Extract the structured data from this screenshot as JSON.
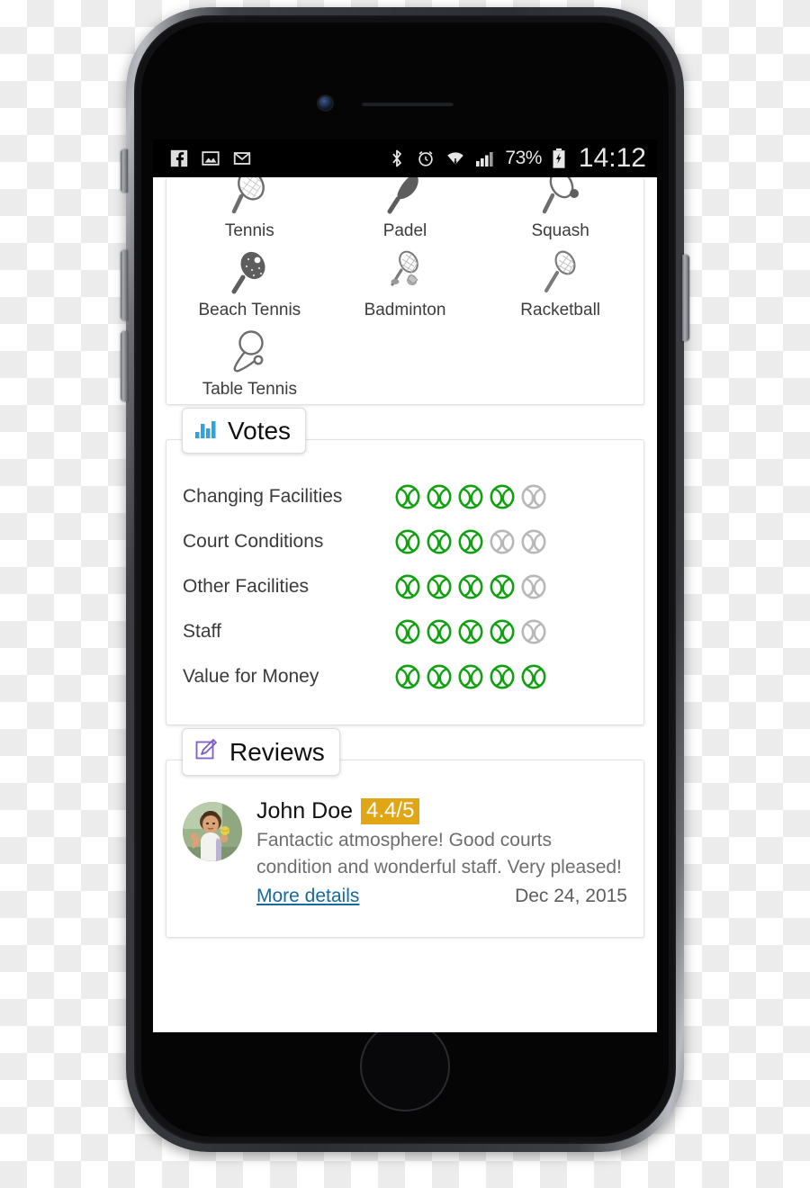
{
  "statusbar": {
    "left_icons": [
      "facebook-icon",
      "photos-icon",
      "gmail-icon"
    ],
    "right_icons": [
      "bluetooth-icon",
      "alarm-icon",
      "wifi-icon",
      "signal-icon"
    ],
    "battery_percent": "73%",
    "battery_icon": "battery-charging-icon",
    "clock": "14:12"
  },
  "sports": {
    "items": [
      {
        "label": "Tennis",
        "icon": "tennis-racket-icon"
      },
      {
        "label": "Padel",
        "icon": "padel-racket-icon"
      },
      {
        "label": "Squash",
        "icon": "squash-racket-icon"
      },
      {
        "label": "Beach Tennis",
        "icon": "beach-tennis-racket-icon"
      },
      {
        "label": "Badminton",
        "icon": "badminton-racket-icon"
      },
      {
        "label": "Racketball",
        "icon": "racketball-racket-icon"
      },
      {
        "label": "Table Tennis",
        "icon": "table-tennis-paddle-icon"
      }
    ]
  },
  "votes": {
    "title": "Votes",
    "icon": "bar-chart-icon",
    "max": 5,
    "rows": [
      {
        "label": "Changing Facilities",
        "value": 4
      },
      {
        "label": "Court Conditions",
        "value": 3
      },
      {
        "label": "Other Facilities",
        "value": 4
      },
      {
        "label": "Staff",
        "value": 4
      },
      {
        "label": "Value for Money",
        "value": 5
      }
    ]
  },
  "reviews": {
    "title": "Reviews",
    "icon": "edit-square-icon",
    "items": [
      {
        "author": "John Doe",
        "rating": "4.4/5",
        "text": "Fantactic atmosphere! Good courts condition and wonderful staff. Very pleased!",
        "link": "More details",
        "date": "Dec 24, 2015",
        "avatar": "tennis-player-avatar"
      }
    ]
  },
  "colors": {
    "rating_filled": "#11a011",
    "rating_empty": "#b7b7b7",
    "badge_amber": "#e0a615",
    "link_blue": "#16699e",
    "chart_blue": "#2fa3dd",
    "edit_purple": "#7a5fc4"
  }
}
